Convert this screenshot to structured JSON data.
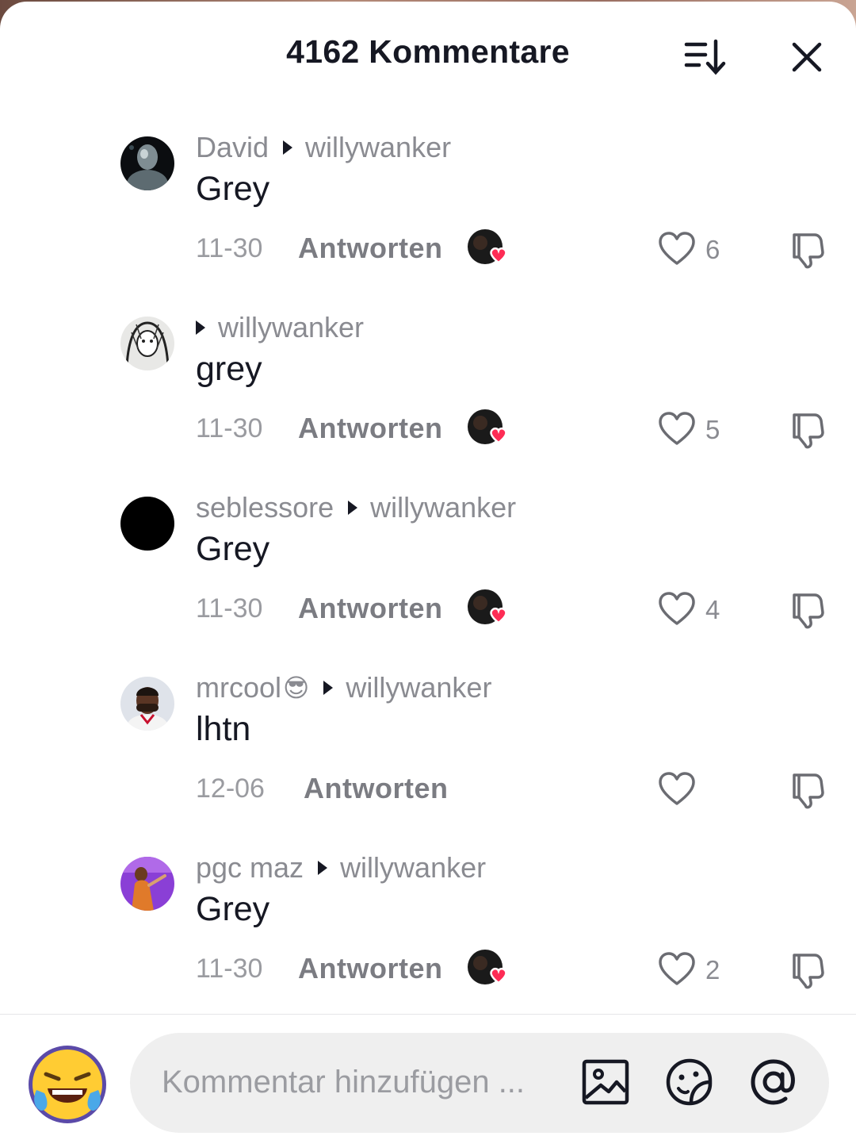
{
  "header": {
    "title": "4162 Kommentare",
    "sort_icon": "sort-icon",
    "close_icon": "close-icon"
  },
  "reply_label": "Antworten",
  "comments": [
    {
      "user": "David",
      "reply_to": "willywanker",
      "text": "Grey",
      "date": "11-30",
      "likes": "6",
      "creator_liked": true,
      "avatar": "statue-avatar"
    },
    {
      "user": "",
      "reply_to": "willywanker",
      "text": "grey",
      "date": "11-30",
      "likes": "5",
      "creator_liked": true,
      "avatar": "sketch-avatar"
    },
    {
      "user": "seblessore",
      "reply_to": "willywanker",
      "text": "Grey",
      "date": "11-30",
      "likes": "4",
      "creator_liked": true,
      "avatar": "black-avatar"
    },
    {
      "user": "mrcool",
      "user_emoji": "😎",
      "reply_to": "willywanker",
      "text": "lhtn",
      "date": "12-06",
      "likes": "",
      "creator_liked": false,
      "avatar": "player-avatar"
    },
    {
      "user": "pgc maz",
      "reply_to": "willywanker",
      "text": "Grey",
      "date": "11-30",
      "likes": "2",
      "creator_liked": true,
      "avatar": "purple-avatar"
    }
  ],
  "footer": {
    "placeholder": "Kommentar hinzufügen ...",
    "emoji": "😂",
    "icons": [
      "image-icon",
      "sticker-icon",
      "mention-icon"
    ]
  },
  "colors": {
    "heart_red": "#fe2c55",
    "text": "#161823",
    "muted": "#8a8b91"
  }
}
